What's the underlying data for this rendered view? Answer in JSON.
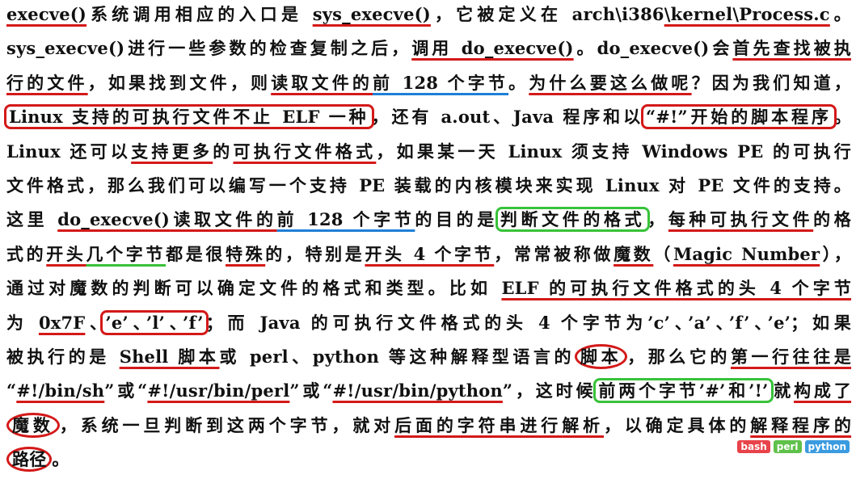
{
  "lines": [
    [
      {
        "text": "execve()",
        "mark": "ul-red"
      },
      {
        "text": "系统调用相应的入口是 "
      },
      {
        "text": "sys_execve()",
        "mark": "ul-red"
      },
      {
        "text": "，它被定义在 arch\\i386"
      },
      {
        "text": "\\kernel\\Process.c",
        "mark": "ul-red"
      },
      {
        "text": "。"
      }
    ],
    [
      {
        "text": "sys_execve()进行一些参数的检查复制之后，"
      },
      {
        "text": "调用 do_execve()",
        "mark": "ul-red"
      },
      {
        "text": "。do_execve()会"
      },
      {
        "text": "首先查找被执",
        "mark": "ul-red"
      }
    ],
    [
      {
        "text": "行的文件",
        "mark": "ul-red"
      },
      {
        "text": "，如果找到文件，则"
      },
      {
        "text": "读取文件的",
        "mark": "ul-red"
      },
      {
        "text": "前 128 个字节",
        "mark": "ul-blue"
      },
      {
        "text": "。"
      },
      {
        "text": "为什么要这么做呢",
        "mark": "ul-red"
      },
      {
        "text": "？因为我们知道，"
      }
    ],
    [
      {
        "text": "Linux 支持的可执行文件不止 ELF 一种",
        "mark": "box-red"
      },
      {
        "text": "，还有 a.out、Java 程序和以"
      },
      {
        "text": "“#!”开始的脚本程序",
        "mark": "box-red"
      },
      {
        "text": "。"
      }
    ],
    [
      {
        "text": "Linux 还可以"
      },
      {
        "text": "支持更多",
        "mark": "ul-red"
      },
      {
        "text": "的"
      },
      {
        "text": "可执行文件格式",
        "mark": "ul-red"
      },
      {
        "text": "，如果某一天 Linux 须支持 Windows PE 的可执行"
      }
    ],
    [
      {
        "text": "文件格式，那么我们可以编写一个支持 PE 装载的内核模块来实现 Linux 对 PE 文件的支持。"
      }
    ],
    [
      {
        "text": "这里 "
      },
      {
        "text": "do_execve()",
        "mark": "ul-red"
      },
      {
        "text": "读取文件的",
        "mark": "ul-red"
      },
      {
        "text": "前 128 个字节",
        "mark": "ul-blue"
      },
      {
        "text": "的目的是"
      },
      {
        "text": "判断文件的格式",
        "mark": "box-green"
      },
      {
        "text": "，"
      },
      {
        "text": "每种",
        "mark": "ul-red"
      },
      {
        "text": "可执行文件",
        "mark": "ul-red"
      },
      {
        "text": "的格"
      }
    ],
    [
      {
        "text": "式的"
      },
      {
        "text": "开头",
        "mark": "ul-red"
      },
      {
        "text": "几个字节",
        "mark": "ul-green"
      },
      {
        "text": "都是很"
      },
      {
        "text": "特殊",
        "mark": "ul-red"
      },
      {
        "text": "的，特别是"
      },
      {
        "text": "开头 4 个字节",
        "mark": "ul-red"
      },
      {
        "text": "，常常被称做"
      },
      {
        "text": "魔数",
        "mark": "ul-red"
      },
      {
        "text": "（"
      },
      {
        "text": "Magic Number",
        "mark": "ul-red"
      },
      {
        "text": "），"
      }
    ],
    [
      {
        "text": "通过对魔数的判断可以确定文件的格式和类型。比如 "
      },
      {
        "text": "ELF 的可执行文件格式的头 4 个字节",
        "mark": "ul-red"
      }
    ],
    [
      {
        "text": "为 "
      },
      {
        "text": "0x7F",
        "mark": "ul-red"
      },
      {
        "text": "、"
      },
      {
        "text": "’e’、’l’、’f’",
        "mark": "box-red"
      },
      {
        "text": "；而 Java 的可执行文件格式的头 4 个字节为’c’、’a’、’f’、’e’；如果"
      }
    ],
    [
      {
        "text": "被执行的是 "
      },
      {
        "text": "Shell 脚本",
        "mark": "ul-red"
      },
      {
        "text": "或 perl、python 等这种解释型语言的"
      },
      {
        "text": "脚本",
        "mark": "circle-red"
      },
      {
        "text": "，那么它的"
      },
      {
        "text": "第一行往往是",
        "mark": "ul-red"
      }
    ],
    [
      {
        "text": "“"
      },
      {
        "text": "#!/bin/sh",
        "mark": "ul-red"
      },
      {
        "text": "”或“"
      },
      {
        "text": "#!/usr/bin/perl",
        "mark": "ul-red"
      },
      {
        "text": "”或“"
      },
      {
        "text": "#!/usr/bin/python",
        "mark": "ul-red"
      },
      {
        "text": "”，这时候"
      },
      {
        "text": "前两个字节’#’和’!’",
        "mark": "box-green"
      },
      {
        "text": "就"
      },
      {
        "text": "构成了",
        "mark": "ul-red"
      }
    ],
    [
      {
        "text": "魔数",
        "mark": "circle-red"
      },
      {
        "text": "，系统一旦判断到这两个字节，就对"
      },
      {
        "text": "后面的字符串进行",
        "mark": "ul-red"
      },
      {
        "text": "解析",
        "mark": "ul-red"
      },
      {
        "text": "，以确定具体的"
      },
      {
        "text": "解释程序的",
        "mark": "ul-red"
      }
    ],
    [
      {
        "text": "路径",
        "mark": "circle-red"
      },
      {
        "text": "。"
      }
    ]
  ],
  "tags": [
    {
      "label": "bash",
      "color": "#e8434a"
    },
    {
      "label": "perl",
      "color": "#5fc14a"
    },
    {
      "label": "python",
      "color": "#3b9be0"
    }
  ]
}
